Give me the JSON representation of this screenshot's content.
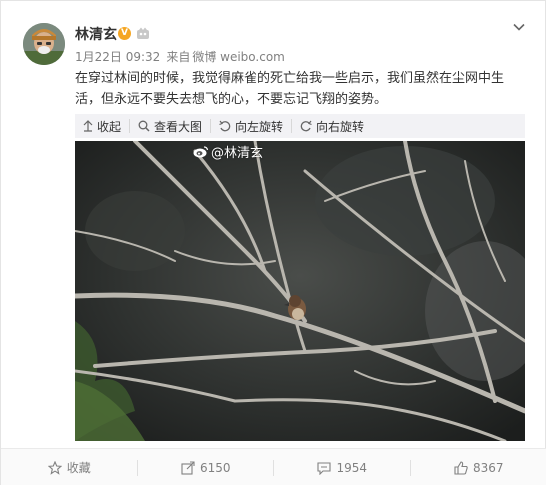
{
  "post": {
    "author": "林清玄",
    "verified_icon": "verified-v-badge",
    "member_icon": "member-crown-icon",
    "date": "1月22日 09:32",
    "source_prefix": "来自",
    "source": "微博 weibo.com",
    "text": "在穿过林间的时候，我觉得麻雀的死亡给我一些启示，我们虽然在尘网中生活，但永远不要失去想飞的心，不要忘记飞翔的姿势。",
    "image_watermark": "@林清玄"
  },
  "toolbar": {
    "collapse": "收起",
    "view_large": "查看大图",
    "rotate_left": "向左旋转",
    "rotate_right": "向右旋转"
  },
  "footer": {
    "favorite": "收藏",
    "reposts": "6150",
    "comments": "1954",
    "likes": "8367"
  },
  "colors": {
    "accent": "#f5a623",
    "meta_text": "#808080",
    "toolbar_bg": "#f2f2f5"
  }
}
